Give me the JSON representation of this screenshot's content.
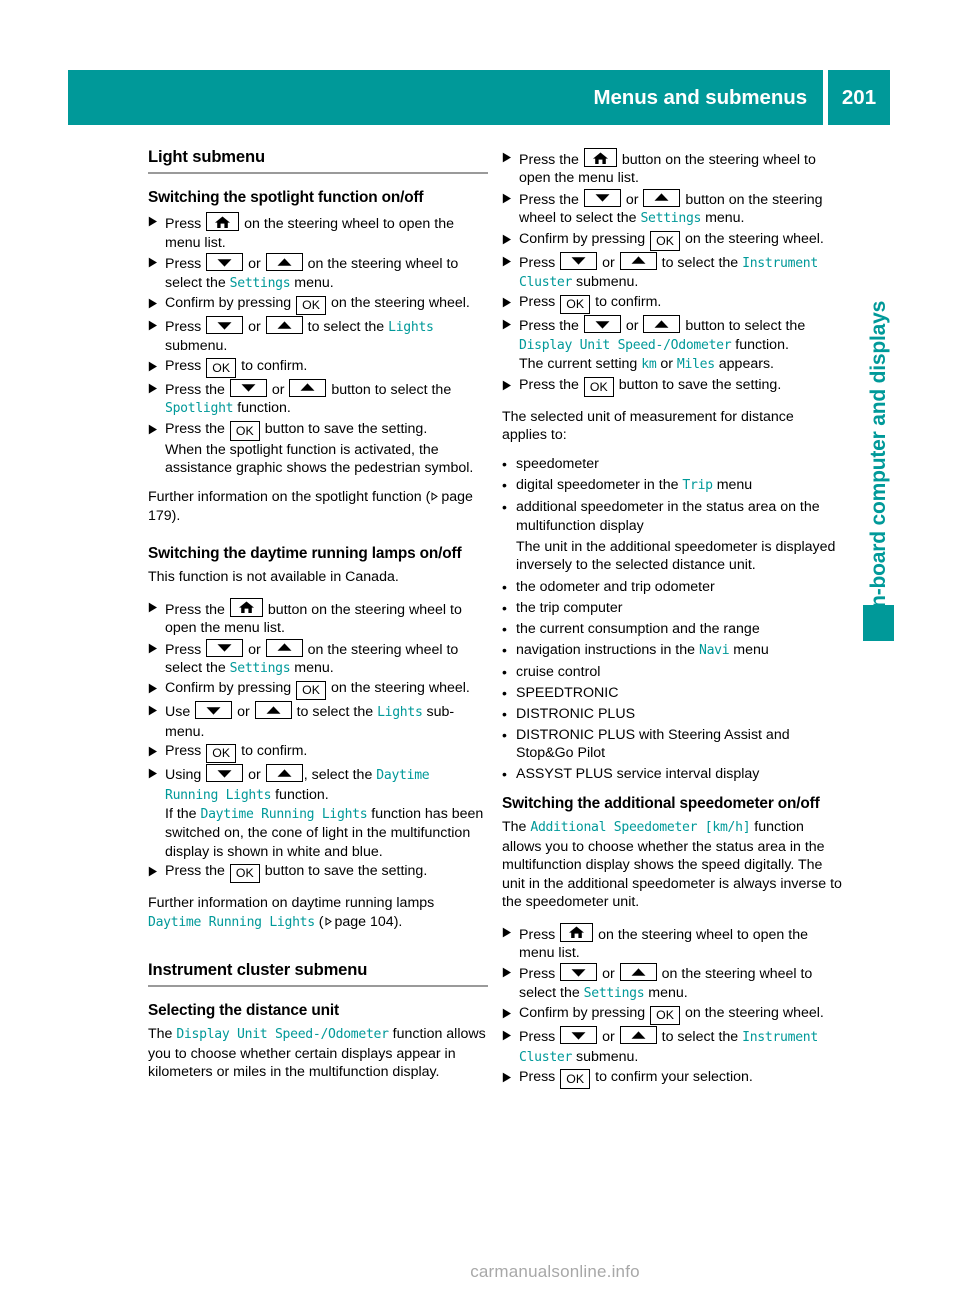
{
  "header": {
    "title": "Menus and submenus",
    "page_number": "201"
  },
  "side_tab": {
    "label": "On-board computer and displays"
  },
  "footer": {
    "watermark": "carmanualsonline.info"
  },
  "icons": {
    "home": "home-icon",
    "down": "arrow-down-icon",
    "up": "arrow-up-icon",
    "ok": "OK",
    "xref": "xref-triangle-icon",
    "step": "step-triangle-icon",
    "bullet": "•"
  },
  "colors": {
    "teal": "#009999",
    "rule_gray": "#9a9a9a",
    "watermark_gray": "#a8a8a8",
    "text": "#000000"
  },
  "left_column": {
    "section_heading": "Light submenu",
    "sub1_heading": "Switching the spotlight function on/off",
    "sub1_steps": [
      {
        "pre": "Press ",
        "key": "home",
        "post": " on the steering wheel to open the menu list."
      },
      {
        "pre": "Press ",
        "key": "downup",
        "post_a": " on the steering wheel to select the ",
        "ui": "Settings",
        "post_b": " menu."
      },
      {
        "pre": "Confirm by pressing ",
        "key": "ok",
        "post": " on the steering wheel."
      },
      {
        "pre": "Press ",
        "key": "downup",
        "post_a": " to select the ",
        "ui": "Lights",
        "post_b": " submenu."
      },
      {
        "pre": "Press ",
        "key": "ok",
        "post": " to confirm."
      },
      {
        "pre": "Press the ",
        "key": "downup",
        "post_a": " button to select the ",
        "ui": "Spotlight",
        "post_b": " function."
      },
      {
        "pre": "Press the ",
        "key": "ok",
        "post": " button to save the setting.",
        "note": "When the spotlight function is activated, the assistance graphic shows the pedestrian symbol."
      }
    ],
    "sub1_further_a": "Further information on the spotlight function (",
    "sub1_further_page": "page 179",
    "sub1_further_b": ").",
    "sub2_heading": "Switching the daytime running lamps on/off",
    "sub2_intro": "This function is not available in Canada.",
    "sub2_steps": [
      {
        "pre": "Press the ",
        "key": "home",
        "post": " button on the steering wheel to open the menu list."
      },
      {
        "pre": "Press ",
        "key": "downup",
        "post_a": " on the steering wheel to select the ",
        "ui": "Settings",
        "post_b": " menu."
      },
      {
        "pre": "Confirm by pressing ",
        "key": "ok",
        "post": " on the steering wheel."
      },
      {
        "pre": "Use ",
        "key": "downup",
        "post_a": " to select the ",
        "ui": "Lights",
        "post_b": " sub-menu."
      },
      {
        "pre": "Press ",
        "key": "ok",
        "post": " to confirm."
      },
      {
        "pre": "Using ",
        "key": "downup",
        "post_a": ", select the ",
        "ui": "Daytime Running Lights",
        "post_b": " function.",
        "note_pre": "If the ",
        "note_ui": "Daytime Running Lights",
        "note_post": " function has been switched on, the cone of light in the multifunction display is shown in white and blue."
      },
      {
        "pre": "Press the ",
        "key": "ok",
        "post": " button to save the setting."
      }
    ],
    "sub2_further_a": "Further information on daytime running lamps ",
    "sub2_further_ui": "Daytime Running Lights",
    "sub2_further_mid": " (",
    "sub2_further_page": "page 104",
    "sub2_further_b": ").",
    "section2_heading": "Instrument cluster submenu",
    "sub3_heading": "Selecting the distance unit",
    "sub3_body_a": "The ",
    "sub3_body_ui": "Display Unit Speed-/Odometer",
    "sub3_body_b": " function allows you to choose whether certain displays appear in kilometers or miles in the multifunction display."
  },
  "right_column": {
    "steps_top": [
      {
        "pre": "Press the ",
        "key": "home",
        "post": " button on the steering wheel to open the menu list."
      },
      {
        "pre": "Press the ",
        "key": "downup",
        "post_a": " button on the steering wheel to select the ",
        "ui": "Settings",
        "post_b": " menu."
      },
      {
        "pre": "Confirm by pressing ",
        "key": "ok",
        "post": " on the steering wheel."
      },
      {
        "pre": "Press ",
        "key": "downup",
        "post_a": " to select the ",
        "ui": "Instrument Cluster",
        "post_b": " submenu."
      },
      {
        "pre": "Press ",
        "key": "ok",
        "post": " to confirm."
      },
      {
        "pre": "Press the ",
        "key": "downup",
        "post_a": " button to select the ",
        "ui": "Display Unit Speed-/Odometer",
        "post_b": " function.",
        "note_pre": "The current setting ",
        "note_ui1": "km",
        "note_mid": " or ",
        "note_ui2": "Miles",
        "note_post": " appears."
      },
      {
        "pre": "Press the ",
        "key": "ok",
        "post": " button to save the setting."
      }
    ],
    "applies_intro": "The selected unit of measurement for distance applies to:",
    "applies_bullets": [
      {
        "text": "speedometer"
      },
      {
        "pre": "digital speedometer in the ",
        "ui": "Trip",
        "post": " menu"
      },
      {
        "text": "additional speedometer in the status area on the multifunction display",
        "sub": "The unit in the additional speedometer is displayed inversely to the selected distance unit."
      },
      {
        "text": "the odometer and trip odometer"
      },
      {
        "text": "the trip computer"
      },
      {
        "text": "the current consumption and the range"
      },
      {
        "pre": "navigation instructions in the ",
        "ui": "Navi",
        "post": " menu"
      },
      {
        "text": "cruise control"
      },
      {
        "text": "SPEEDTRONIC"
      },
      {
        "text": "DISTRONIC PLUS"
      },
      {
        "text": "DISTRONIC PLUS with Steering Assist and Stop&Go Pilot"
      },
      {
        "text": "ASSYST PLUS service interval display"
      }
    ],
    "sub_heading": "Switching the additional speedometer on/off",
    "sub_body_a": "The ",
    "sub_body_ui": "Additional Speedometer [km/h]",
    "sub_body_b": " function allows you to choose whether the status area in the multifunction display shows the speed digitally. The unit in the additional speedometer is always inverse to the speedometer unit.",
    "steps_bottom": [
      {
        "pre": "Press ",
        "key": "home",
        "post": " on the steering wheel to open the menu list."
      },
      {
        "pre": "Press ",
        "key": "downup",
        "post_a": " on the steering wheel to select the ",
        "ui": "Settings",
        "post_b": " menu."
      },
      {
        "pre": "Confirm by pressing ",
        "key": "ok",
        "post": " on the steering wheel."
      },
      {
        "pre": "Press ",
        "key": "downup",
        "post_a": " to select the ",
        "ui": "Instrument Cluster",
        "post_b": " submenu."
      },
      {
        "pre": "Press ",
        "key": "ok",
        "post": " to confirm your selection."
      }
    ]
  }
}
